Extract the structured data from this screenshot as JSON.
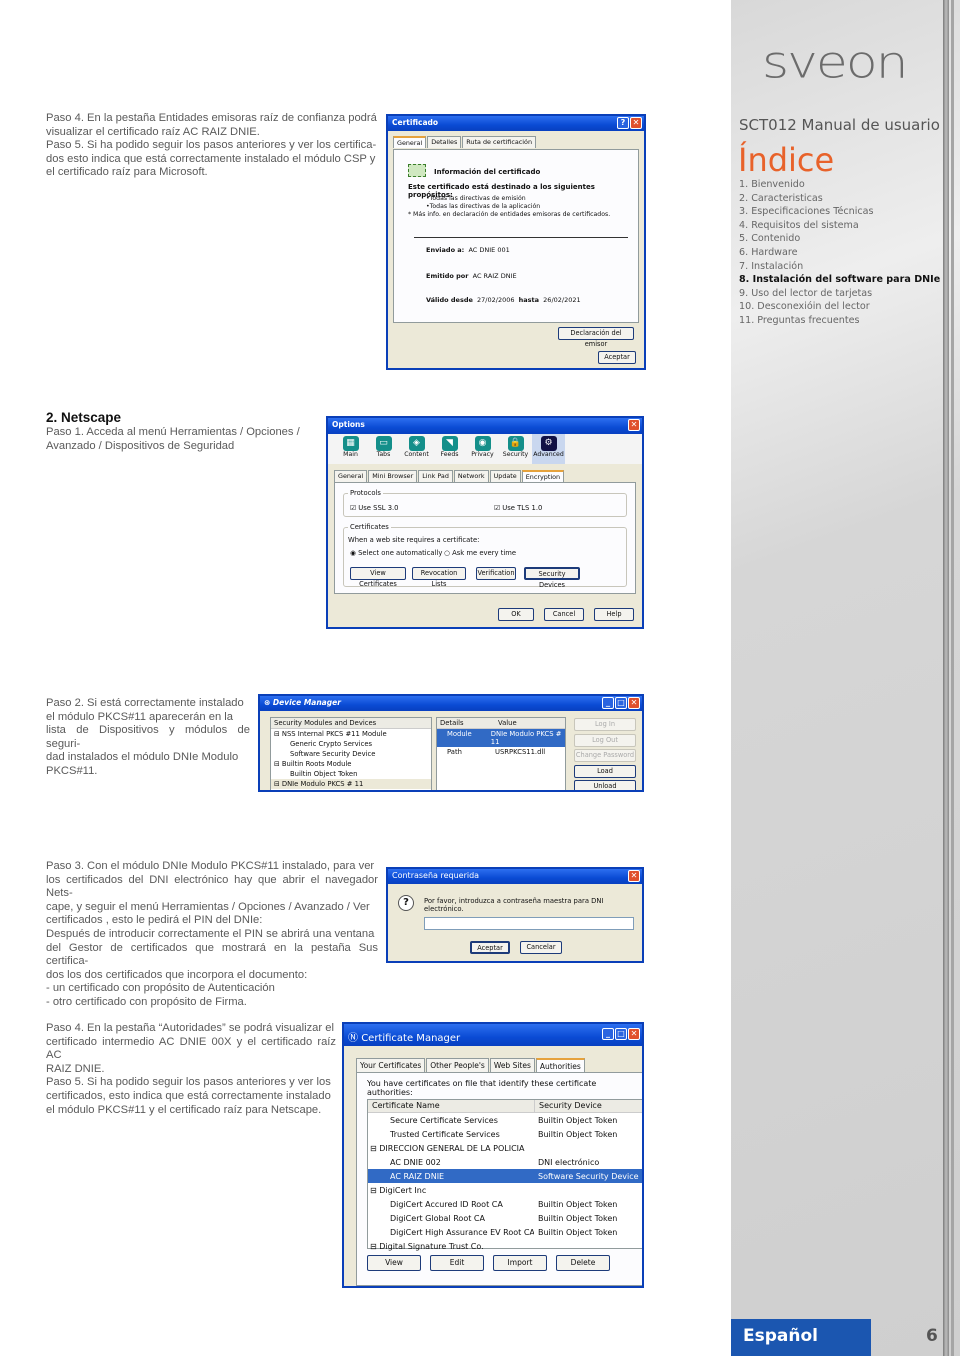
{
  "sections": {
    "microsoft_text": [
      "Paso 4. En la pestaña Entidades emisoras raíz de confianza podrá",
      "visualizar el certificado raíz AC RAIZ DNIE.",
      "Paso 5. Si ha podido seguir los pasos anteriores y ver los certifica-",
      "dos esto indica que está correctamente instalado el módulo CSP y",
      "el certificado raíz para Microsoft."
    ],
    "netscape_heading": "2. Netscape",
    "netscape_step1": [
      "Paso 1. Acceda al menú Herramientas / Opciones /",
      "Avanzado / Dispositivos de Seguridad"
    ],
    "netscape_step2": [
      "Paso 2. Si está correctamente instalado",
      "el módulo PKCS#11 aparecerán en la",
      "lista de Dispositivos y módulos de seguri-",
      "dad instalados el módulo DNIe Modulo",
      "PKCS#11."
    ],
    "netscape_step3": [
      "Paso 3. Con el módulo DNIe Modulo PKCS#11 instalado, para ver",
      "los certificados del DNI electrónico hay que abrir el navegador Nets-",
      "cape, y seguir el menú Herramientas / Opciones / Avanzado / Ver",
      "certificados , esto le pedirá el PIN del DNIe:",
      "Después de introducir correctamente el PIN se abrirá una ventana",
      "del Gestor de certificados que mostrará en la pestaña Sus certifica-",
      "dos los dos certificados que incorpora el documento:",
      "- un certificado con propósito de Autenticación",
      "-  otro certificado con propósito de Firma."
    ],
    "netscape_step45": [
      "Paso 4. En la pestaña “Autoridades” se podrá visualizar el",
      "certificado intermedio AC DNIE 00X y el certificado raíz AC",
      "RAIZ DNIE.",
      "Paso 5. Si ha podido seguir los pasos anteriores y ver los",
      "certificados, esto indica que está correctamente instalado",
      "el módulo PKCS#11 y el certificado raíz para Netscape."
    ]
  },
  "cert_dialog": {
    "title": "Certificado",
    "tabs": [
      "General",
      "Detalles",
      "Ruta de certificación"
    ],
    "info_heading": "Información del certificado",
    "purpose_heading": "Este certificado está destinado a los siguientes propósitos:",
    "purposes": [
      "•Todas las directivas de emisión",
      "•Todas las directivas de la aplicación"
    ],
    "more_info": "* Más info. en declaración de entidades emisoras de certificados.",
    "sent_to_label": "Enviado a:",
    "sent_to": "AC DNIE 001",
    "issued_by_label": "Emitido por",
    "issued_by": "AC RAIZ DNIE",
    "valid_from_label": "Válido desde",
    "valid_from": "27/02/2006",
    "valid_to_label": "hasta",
    "valid_to": "26/02/2021",
    "issuer_statement_button": "Declaración del emisor",
    "ok_button": "Aceptar"
  },
  "options_dialog": {
    "title": "Options",
    "toolbar": [
      {
        "label": "Main",
        "icon": "main-icon"
      },
      {
        "label": "Tabs",
        "icon": "tabs-icon"
      },
      {
        "label": "Content",
        "icon": "content-icon"
      },
      {
        "label": "Feeds",
        "icon": "feeds-icon"
      },
      {
        "label": "Privacy",
        "icon": "privacy-icon"
      },
      {
        "label": "Security",
        "icon": "lock-icon"
      },
      {
        "label": "Advanced",
        "icon": "gear-icon"
      }
    ],
    "tabs": [
      "General",
      "Mini Browser",
      "Link Pad",
      "Network",
      "Update",
      "Encryption"
    ],
    "protocols_label": "Protocols",
    "ssl": "Use SSL 3.0",
    "tls": "Use TLS 1.0",
    "certificates_label": "Certificates",
    "when_required": "When a web site requires a certificate:",
    "radio_auto": "Select one automatically",
    "radio_ask": "Ask me every time",
    "buttons": [
      "View Certificates",
      "Revocation Lists",
      "Verification",
      "Security Devices"
    ],
    "ok": "OK",
    "cancel": "Cancel",
    "help": "Help"
  },
  "device_manager": {
    "title": "Device Manager",
    "tree_header": "Security Modules and Devices",
    "tree": [
      {
        "label": "⊟ NSS Internal PKCS #11 Module",
        "level": 0
      },
      {
        "label": "Generic Crypto Services",
        "level": 1
      },
      {
        "label": "Software Security Device",
        "level": 1
      },
      {
        "label": "⊟ Builtin Roots Module",
        "level": 0
      },
      {
        "label": "Builtin Object Token",
        "level": 1
      },
      {
        "label": "⊟ DNIe Modulo PKCS # 11",
        "level": 0
      }
    ],
    "details_header": "Details",
    "value_header": "Value",
    "details": [
      {
        "key": "Module",
        "value": "DNIe Modulo PKCS # 11"
      },
      {
        "key": "Path",
        "value": "USRPKCS11.dll"
      }
    ],
    "buttons": [
      "Log In",
      "Log Out",
      "Change Password",
      "Load",
      "Unload"
    ]
  },
  "password_dialog": {
    "title": "Contraseña requerida",
    "message": "Por favor, introduzca a contraseña maestra para DNI electrónico.",
    "input_value": "",
    "ok": "Aceptar",
    "cancel": "Cancelar"
  },
  "cert_manager": {
    "title": "Certificate Manager",
    "tabs": [
      "Your Certificates",
      "Other People's",
      "Web Sites",
      "Authorities"
    ],
    "description": "You have certificates on file that identify these certificate authorities:",
    "col_name": "Certificate Name",
    "col_device": "Security Device",
    "rows": [
      {
        "name": "Secure Certificate Services",
        "device": "Builtin Object Token",
        "level": 1
      },
      {
        "name": "Trusted Certificate Services",
        "device": "Builtin Object Token",
        "level": 1
      },
      {
        "name": "⊟ DIRECCION GENERAL DE LA POLICIA",
        "device": "",
        "level": 0
      },
      {
        "name": "AC DNIE 002",
        "device": "DNI electrónico",
        "level": 1
      },
      {
        "name": "AC RAIZ DNIE",
        "device": "Software Security Device",
        "level": 1,
        "selected": true
      },
      {
        "name": "⊟ DigiCert Inc",
        "device": "",
        "level": 0
      },
      {
        "name": "DigiCert Accured ID Root CA",
        "device": "Builtin Object Token",
        "level": 1
      },
      {
        "name": "DigiCert Global Root CA",
        "device": "Builtin Object Token",
        "level": 1
      },
      {
        "name": "DigiCert High Assurance EV Root CA",
        "device": "Builtin Object Token",
        "level": 1
      },
      {
        "name": "⊟ Digital Signature Trust Co.",
        "device": "",
        "level": 0
      }
    ],
    "buttons": [
      "View",
      "Edit",
      "Import",
      "Delete"
    ]
  },
  "sidebar": {
    "logo": "sveon",
    "manual_title": "SCT012 Manual de usuario",
    "index_title": "Índice",
    "toc": [
      {
        "label": "1. Bienvenido"
      },
      {
        "label": "2. Caracteristicas"
      },
      {
        "label": "3. Especificaciones Técnicas"
      },
      {
        "label": "4. Requisitos del sistema"
      },
      {
        "label": "5. Contenido"
      },
      {
        "label": "6. Hardware"
      },
      {
        "label": "7. Instalación"
      },
      {
        "label": "8. Instalación del software para DNIe",
        "active": true
      },
      {
        "label": "9. Uso del lector de tarjetas"
      },
      {
        "label": "10. Desconexióin del lector"
      },
      {
        "label": "11. Preguntas frecuentes"
      }
    ],
    "language": "Español",
    "page_number": "6",
    "accent_color": "#e8622a",
    "language_color": "#1b56b0"
  }
}
